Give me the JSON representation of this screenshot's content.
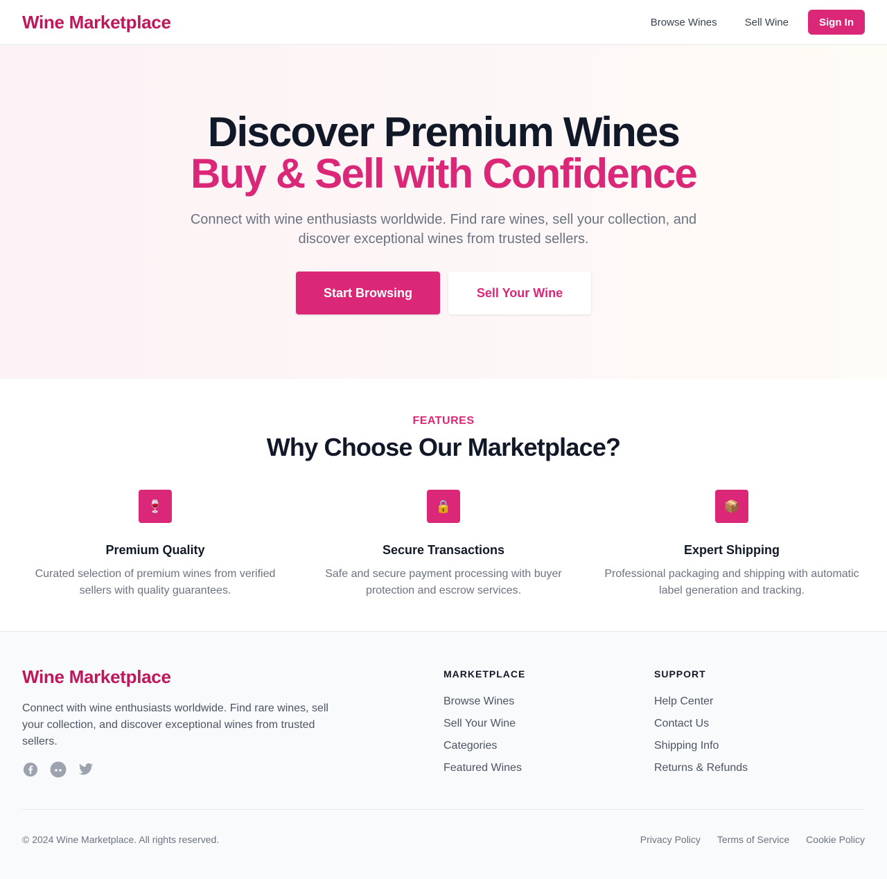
{
  "header": {
    "brand": "Wine Marketplace",
    "nav": [
      "Browse Wines",
      "Sell Wine"
    ],
    "signin": "Sign In"
  },
  "hero": {
    "title_line1": "Discover Premium Wines",
    "title_line2": "Buy & Sell with Confidence",
    "subtitle": "Connect with wine enthusiasts worldwide. Find rare wines, sell your collection, and discover exceptional wines from trusted sellers.",
    "primary_button": "Start Browsing",
    "secondary_button": "Sell Your Wine"
  },
  "features": {
    "eyebrow": "FEATURES",
    "title": "Why Choose Our Marketplace?",
    "items": [
      {
        "icon": "wine-glass-icon",
        "glyph": "🍷",
        "title": "Premium Quality",
        "desc": "Curated selection of premium wines from verified sellers with quality guarantees."
      },
      {
        "icon": "lock-icon",
        "glyph": "🔒",
        "title": "Secure Transactions",
        "desc": "Safe and secure payment processing with buyer protection and escrow services."
      },
      {
        "icon": "package-icon",
        "glyph": "📦",
        "title": "Expert Shipping",
        "desc": "Professional packaging and shipping with automatic label generation and tracking."
      }
    ]
  },
  "footer": {
    "brand": "Wine Marketplace",
    "description": "Connect with wine enthusiasts worldwide. Find rare wines, sell your collection, and discover exceptional wines from trusted sellers.",
    "socials": [
      "facebook-icon",
      "community-icon",
      "twitter-icon"
    ],
    "columns": [
      {
        "title": "MARKETPLACE",
        "links": [
          "Browse Wines",
          "Sell Your Wine",
          "Categories",
          "Featured Wines"
        ]
      },
      {
        "title": "SUPPORT",
        "links": [
          "Help Center",
          "Contact Us",
          "Shipping Info",
          "Returns & Refunds"
        ]
      }
    ],
    "copyright": "© 2024 Wine Marketplace. All rights reserved.",
    "legal": [
      "Privacy Policy",
      "Terms of Service",
      "Cookie Policy"
    ]
  },
  "colors": {
    "brand": "#be185d",
    "accent": "#db2777",
    "text_dark": "#111827",
    "text_muted": "#6b7280"
  }
}
